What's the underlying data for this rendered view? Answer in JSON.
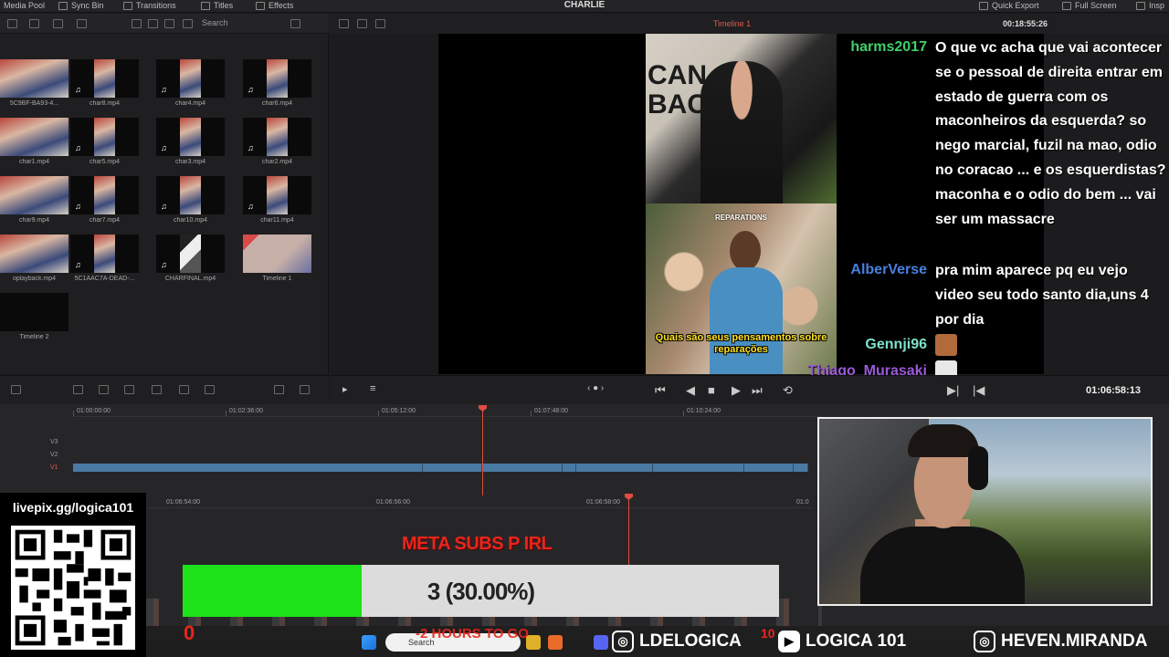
{
  "toolbar": {
    "media_pool": "Media Pool",
    "sync_bin": "Sync Bin",
    "transitions": "Transitions",
    "titles": "Titles",
    "effects": "Effects",
    "app_title": "CHARLIE",
    "quick_export": "Quick Export",
    "full_screen": "Full Screen",
    "inspector": "Insp"
  },
  "media_pool": {
    "search_placeholder": "Search",
    "clips": [
      {
        "label": "5C9BF-BA93-4..."
      },
      {
        "label": "char8.mp4"
      },
      {
        "label": "char4.mp4"
      },
      {
        "label": "char6.mp4"
      },
      {
        "label": "char1.mp4"
      },
      {
        "label": "char5.mp4"
      },
      {
        "label": "char3.mp4"
      },
      {
        "label": "char2.mp4"
      },
      {
        "label": "char9.mp4"
      },
      {
        "label": "char7.mp4"
      },
      {
        "label": "char10.mp4"
      },
      {
        "label": "char11.mp4"
      },
      {
        "label": "oplayback.mp4"
      },
      {
        "label": "5C1AAC7A-DEAD-..."
      },
      {
        "label": "CHARFINAL.mp4"
      },
      {
        "label": "Timeline 1"
      },
      {
        "label": "Timeline 2"
      }
    ]
  },
  "viewer": {
    "timeline_name": "Timeline 1",
    "timecode_top": "00:18:55:26",
    "timecode_main": "01:06:58:13",
    "banner_text": "CAN\nBACK",
    "reparations_label": "REPARATIONS",
    "caption": "Quais são seus pensamentos sobre reparações"
  },
  "chat": [
    {
      "user": "harms2017",
      "color": "#3fd06a",
      "text": "O que vc acha que vai acontecer se o pessoal de direita entrar em estado de guerra com os maconheiros da esquerda? so nego marcial, fuzil na mao, odio no coracao ... e os esquerdistas? maconha e o odio do bem ... vai ser um massacre"
    },
    {
      "user": "AlberVerse",
      "color": "#4a7fe0",
      "text": "pra mim aparece pq eu vejo video seu todo santo dia,uns 4 por dia"
    },
    {
      "user": "Gennji96",
      "color": "#7de0c8",
      "text": ""
    },
    {
      "user": "Thiago_Murasaki",
      "color": "#9b59d8",
      "text": ""
    }
  ],
  "timeline": {
    "ruler_top": [
      "01:00:00:00",
      "01:02:36:00",
      "01:05:12:00",
      "01:07:48:00",
      "01:10:24:00"
    ],
    "ruler_bottom": [
      "01:06:54:00",
      "01:06:56:00",
      "01:06:58:00",
      "01:0"
    ],
    "tracks": [
      "V3",
      "V2",
      "V1"
    ]
  },
  "donation": {
    "url": "livepix.gg/logica101"
  },
  "subs_goal": {
    "title": "META SUBS P IRL",
    "progress_text": "3 (30.00%)",
    "progress": 0.3,
    "start": "0",
    "hours_text": "-2 HOURS TO GO",
    "end": "10",
    "fill_color": "#1de21a"
  },
  "taskbar": {
    "search": "Search",
    "socials": [
      {
        "name": "LDELOGICA",
        "icon": "instagram-icon"
      },
      {
        "name": "LOGICA 101",
        "icon": "youtube-icon"
      },
      {
        "name": "HEVEN.MIRANDA",
        "icon": "instagram-icon"
      }
    ]
  }
}
